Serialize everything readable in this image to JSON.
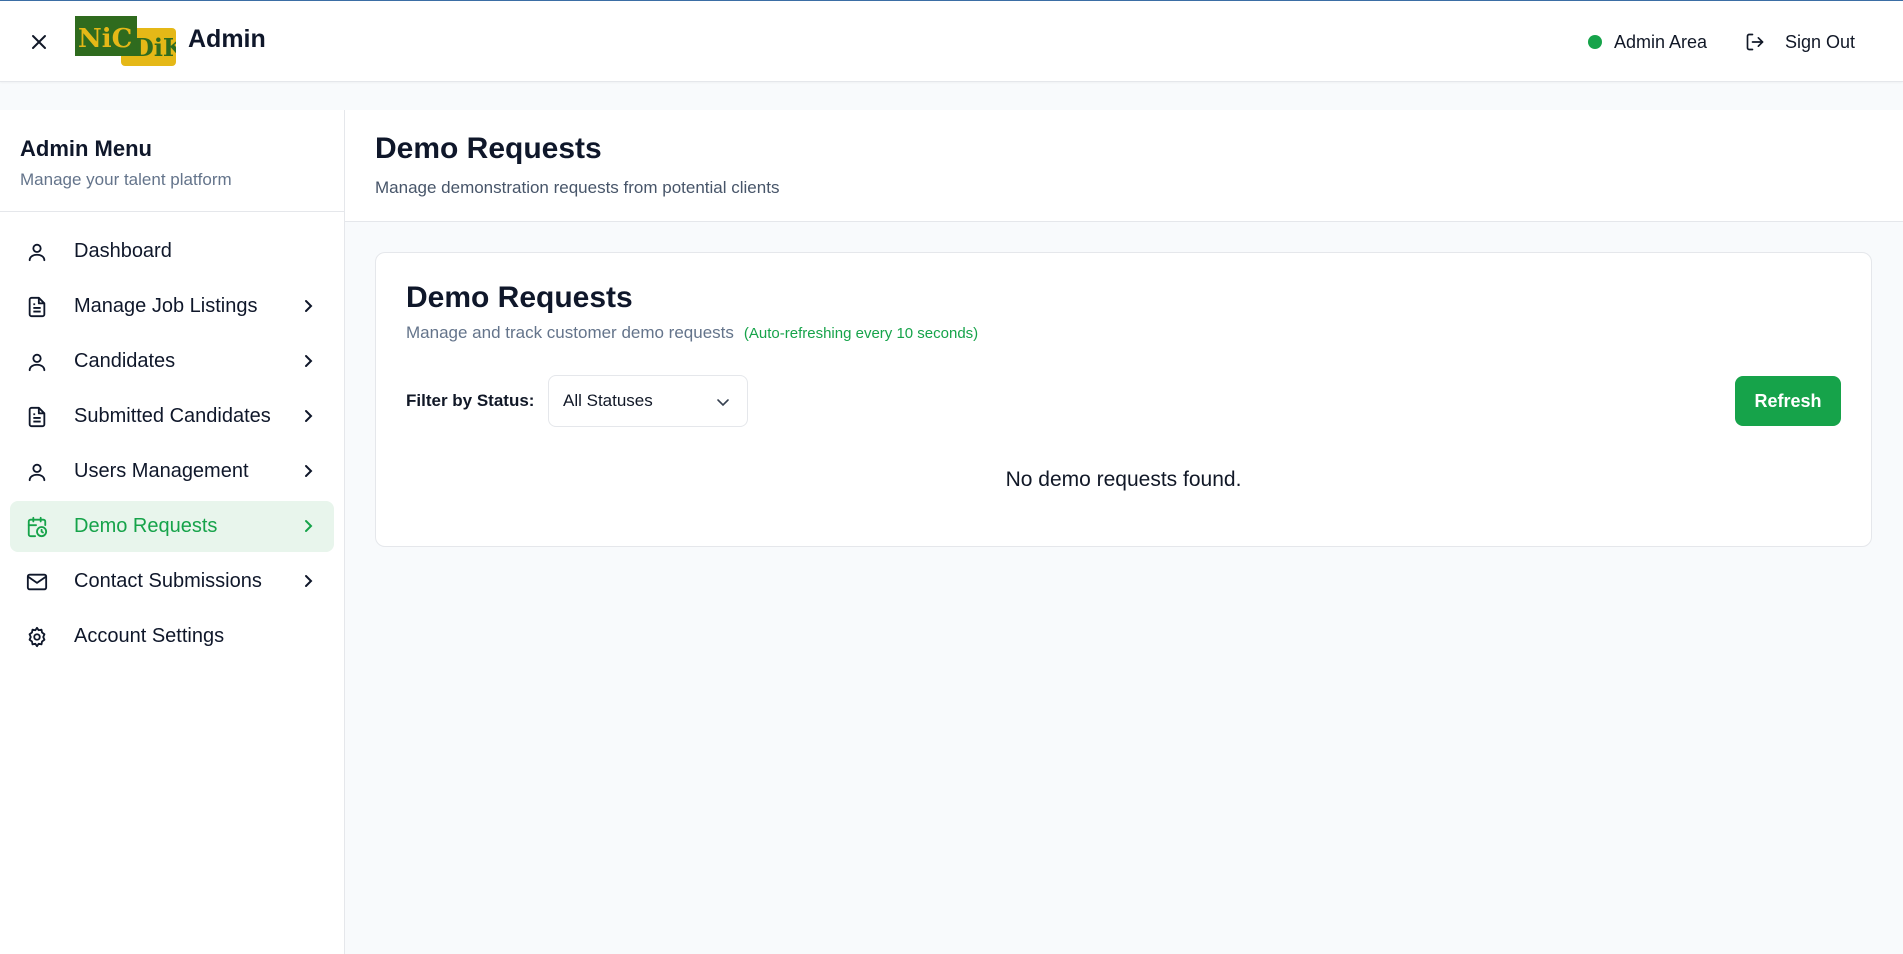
{
  "header": {
    "brand": "Admin",
    "logo_text": "NiCDiK",
    "admin_area_label": "Admin Area",
    "sign_out_label": "Sign Out"
  },
  "sidebar": {
    "title": "Admin Menu",
    "subtitle": "Manage your talent platform",
    "items": [
      {
        "label": "Dashboard",
        "icon": "user-icon"
      },
      {
        "label": "Manage Job Listings",
        "icon": "document-icon"
      },
      {
        "label": "Candidates",
        "icon": "user-icon"
      },
      {
        "label": "Submitted Candidates",
        "icon": "document-icon"
      },
      {
        "label": "Users Management",
        "icon": "user-icon"
      },
      {
        "label": "Demo Requests",
        "icon": "calendar-clock-icon",
        "active": true
      },
      {
        "label": "Contact Submissions",
        "icon": "mail-icon"
      },
      {
        "label": "Account Settings",
        "icon": "gear-icon"
      }
    ]
  },
  "page": {
    "title": "Demo Requests",
    "subtitle": "Manage demonstration requests from potential clients"
  },
  "card": {
    "title": "Demo Requests",
    "subtitle": "Manage and track customer demo requests",
    "auto_refresh_note": "(Auto-refreshing every 10 seconds)",
    "filter_label": "Filter by Status:",
    "filter_value": "All Statuses",
    "refresh_label": "Refresh",
    "empty_message": "No demo requests found."
  },
  "colors": {
    "accent": "#16a34a",
    "active_bg": "#e8f5ec",
    "logo_green": "#2f6b1e",
    "logo_yellow": "#e5b817"
  }
}
